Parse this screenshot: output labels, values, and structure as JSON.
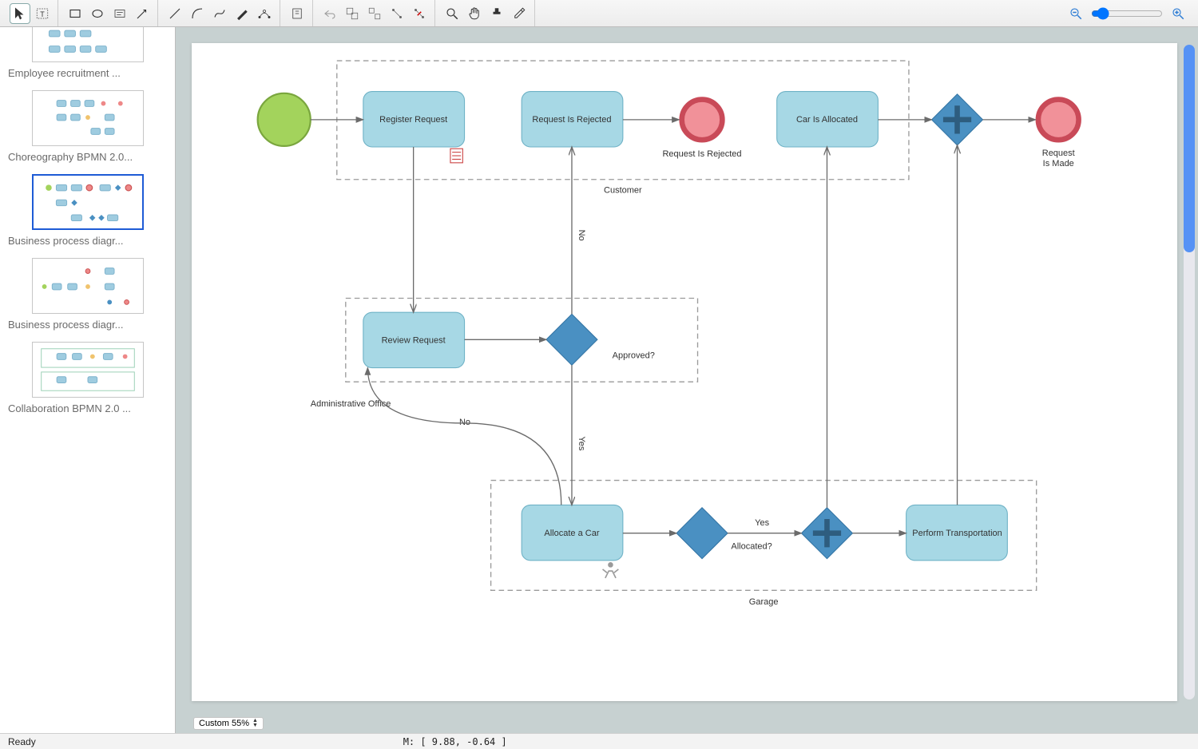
{
  "sidebar": {
    "items": [
      {
        "label": "Employee recruitment ..."
      },
      {
        "label": "Choreography BPMN 2.0..."
      },
      {
        "label": "Business process diagr..."
      },
      {
        "label": "Business process diagr..."
      },
      {
        "label": "Collaboration BPMN 2.0 ..."
      }
    ]
  },
  "diagram": {
    "pools": {
      "customer": "Customer",
      "admin": "Administrative Office",
      "garage": "Garage"
    },
    "tasks": {
      "register": "Register Request",
      "reject": "Request Is Rejected",
      "allocated": "Car Is Allocated",
      "review": "Review Request",
      "allocate": "Allocate a Car",
      "perform": "Perform Transportation"
    },
    "events": {
      "rejectEnd": "Request Is Rejected",
      "madeEnd1": "Request",
      "madeEnd2": "Is Made"
    },
    "gateways": {
      "approved": "Approved?",
      "allocatedQ": "Allocated?"
    },
    "edges": {
      "no": "No",
      "no2": "No",
      "yesV": "Yes",
      "yes": "Yes"
    }
  },
  "zoom_label": "Custom 55%",
  "status": {
    "ready": "Ready",
    "coord": "M: [ 9.88, -0.64 ]"
  }
}
